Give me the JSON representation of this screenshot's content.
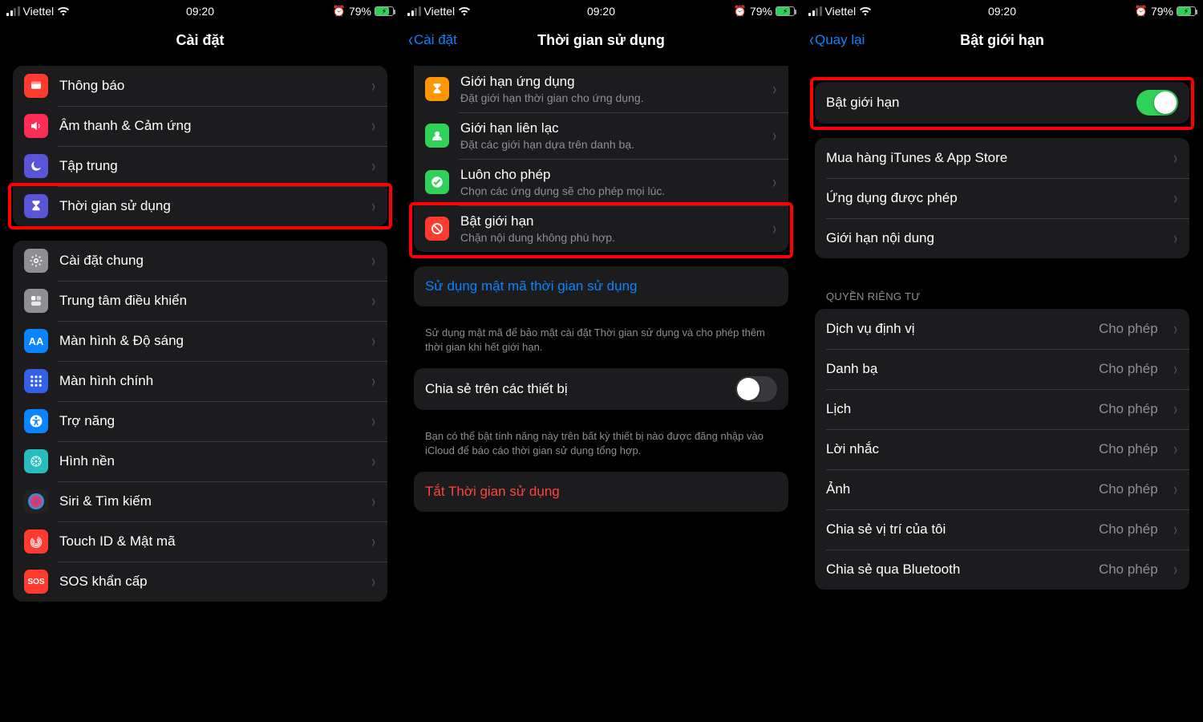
{
  "status": {
    "carrier": "Viettel",
    "time": "09:20",
    "battery_pct": "79%"
  },
  "screen1": {
    "title": "Cài đặt",
    "group1": [
      {
        "label": "Thông báo",
        "icon_bg": "#ff3b30",
        "icon_name": "notifications-icon"
      },
      {
        "label": "Âm thanh & Cảm ứng",
        "icon_bg": "#ff2d55",
        "icon_name": "sound-icon"
      },
      {
        "label": "Tập trung",
        "icon_bg": "#5856d6",
        "icon_name": "moon-icon"
      },
      {
        "label": "Thời gian sử dụng",
        "icon_bg": "#5856d6",
        "icon_name": "hourglass-icon",
        "highlight": true
      }
    ],
    "group2": [
      {
        "label": "Cài đặt chung",
        "icon_bg": "#8e8e93",
        "icon_name": "gear-icon"
      },
      {
        "label": "Trung tâm điều khiển",
        "icon_bg": "#8e8e93",
        "icon_name": "control-center-icon"
      },
      {
        "label": "Màn hình & Độ sáng",
        "icon_bg": "#0a84ff",
        "icon_name": "display-icon",
        "icon_text": "AA"
      },
      {
        "label": "Màn hình chính",
        "icon_bg": "#3260e6",
        "icon_name": "home-screen-icon"
      },
      {
        "label": "Trợ năng",
        "icon_bg": "#0a84ff",
        "icon_name": "accessibility-icon"
      },
      {
        "label": "Hình nền",
        "icon_bg": "#27bdbf",
        "icon_name": "wallpaper-icon"
      },
      {
        "label": "Siri & Tìm kiếm",
        "icon_bg": "#222",
        "icon_name": "siri-icon"
      },
      {
        "label": "Touch ID & Mật mã",
        "icon_bg": "#ff3b30",
        "icon_name": "touchid-icon"
      },
      {
        "label": "SOS khẩn cấp",
        "icon_bg": "#ff3b30",
        "icon_name": "sos-icon",
        "icon_text": "SOS"
      }
    ]
  },
  "screen2": {
    "back": "Cài đặt",
    "title": "Thời gian sử dụng",
    "items": [
      {
        "t": "Giới hạn ứng dụng",
        "s": "Đặt giới hạn thời gian cho ứng dụng.",
        "icon_bg": "#ff9500",
        "icon_name": "hourglass-icon"
      },
      {
        "t": "Giới hạn liên lạc",
        "s": "Đặt các giới hạn dựa trên danh bạ.",
        "icon_bg": "#30d158",
        "icon_name": "contact-limit-icon"
      },
      {
        "t": "Luôn cho phép",
        "s": "Chọn các ứng dụng sẽ cho phép mọi lúc.",
        "icon_bg": "#30d158",
        "icon_name": "always-allowed-icon"
      },
      {
        "t": "Bật giới hạn",
        "s": "Chặn nội dung không phù hợp.",
        "icon_bg": "#ff3b30",
        "icon_name": "no-entry-icon",
        "highlight": true
      }
    ],
    "passcode_label": "Sử dụng mật mã thời gian sử dụng",
    "passcode_hint": "Sử dụng mật mã để bảo mật cài đặt Thời gian sử dụng và cho phép thêm thời gian khi hết giới hạn.",
    "share_label": "Chia sẻ trên các thiết bị",
    "share_hint": "Bạn có thể bật tính năng này trên bất kỳ thiết bị nào được đăng nhập vào iCloud để báo cáo thời gian sử dụng tổng hợp.",
    "turn_off": "Tắt Thời gian sử dụng"
  },
  "screen3": {
    "back": "Quay lại",
    "title": "Bật giới hạn",
    "toggle_label": "Bật giới hạn",
    "toggle_on": true,
    "group_a": [
      {
        "label": "Mua hàng iTunes & App Store"
      },
      {
        "label": "Ứng dụng được phép"
      },
      {
        "label": "Giới hạn nội dung"
      }
    ],
    "privacy_header": "QUYỀN RIÊNG TƯ",
    "allow_value": "Cho phép",
    "privacy": [
      {
        "label": "Dịch vụ định vị"
      },
      {
        "label": "Danh bạ"
      },
      {
        "label": "Lịch"
      },
      {
        "label": "Lời nhắc"
      },
      {
        "label": "Ảnh"
      },
      {
        "label": "Chia sẻ vị trí của tôi"
      },
      {
        "label": "Chia sẻ qua Bluetooth"
      }
    ]
  }
}
